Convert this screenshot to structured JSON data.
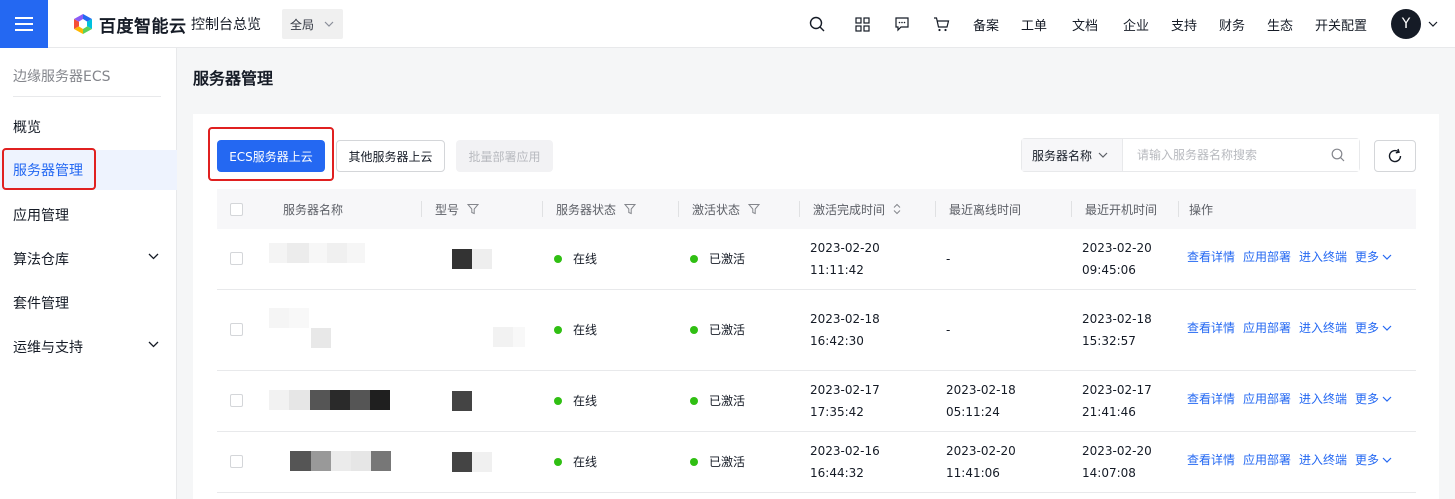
{
  "topbar": {
    "brand": "百度智能云",
    "console": "控制台总览",
    "region": "全局",
    "nav_items": [
      "备案",
      "工单",
      "文档",
      "企业",
      "支持",
      "财务",
      "生态",
      "开关配置"
    ],
    "icons": [
      "search-icon",
      "grid-icon",
      "message-icon",
      "cart-icon"
    ],
    "avatar": "Y"
  },
  "sidebar": {
    "product": "边缘服务器ECS",
    "items": [
      {
        "label": "概览",
        "active": false,
        "expandable": false
      },
      {
        "label": "服务器管理",
        "active": true,
        "expandable": false
      },
      {
        "label": "应用管理",
        "active": false,
        "expandable": false
      },
      {
        "label": "算法仓库",
        "active": false,
        "expandable": true
      },
      {
        "label": "套件管理",
        "active": false,
        "expandable": false
      },
      {
        "label": "运维与支持",
        "active": false,
        "expandable": true
      }
    ]
  },
  "page": {
    "title": "服务器管理"
  },
  "toolbar": {
    "ecs_button": "ECS服务器上云",
    "other_button": "其他服务器上云",
    "batch_button": "批量部署应用",
    "search_key": "服务器名称",
    "search_placeholder": "请输入服务器名称搜索"
  },
  "table": {
    "columns": [
      "服务器名称",
      "型号",
      "服务器状态",
      "激活状态",
      "激活完成时间",
      "最近离线时间",
      "最近开机时间",
      "操作"
    ],
    "actions": [
      "查看详情",
      "应用部署",
      "进入终端",
      "更多"
    ],
    "rows": [
      {
        "server_status": "在线",
        "activation": "已激活",
        "activated_date": "2023-02-20",
        "activated_time": "11:11:42",
        "offline_date": "-",
        "offline_time": "",
        "boot_date": "2023-02-20",
        "boot_time": "09:45:06"
      },
      {
        "server_status": "在线",
        "activation": "已激活",
        "activated_date": "2023-02-18",
        "activated_time": "16:42:30",
        "offline_date": "-",
        "offline_time": "",
        "boot_date": "2023-02-18",
        "boot_time": "15:32:57"
      },
      {
        "server_status": "在线",
        "activation": "已激活",
        "activated_date": "2023-02-17",
        "activated_time": "17:35:42",
        "offline_date": "2023-02-18",
        "offline_time": "05:11:24",
        "boot_date": "2023-02-17",
        "boot_time": "21:41:46"
      },
      {
        "server_status": "在线",
        "activation": "已激活",
        "activated_date": "2023-02-16",
        "activated_time": "16:44:32",
        "offline_date": "2023-02-20",
        "offline_time": "11:41:06",
        "boot_date": "2023-02-20",
        "boot_time": "14:07:08"
      }
    ]
  },
  "colors": {
    "primary": "#2468f2",
    "online": "#30bf13",
    "highlight": "#e02020"
  }
}
